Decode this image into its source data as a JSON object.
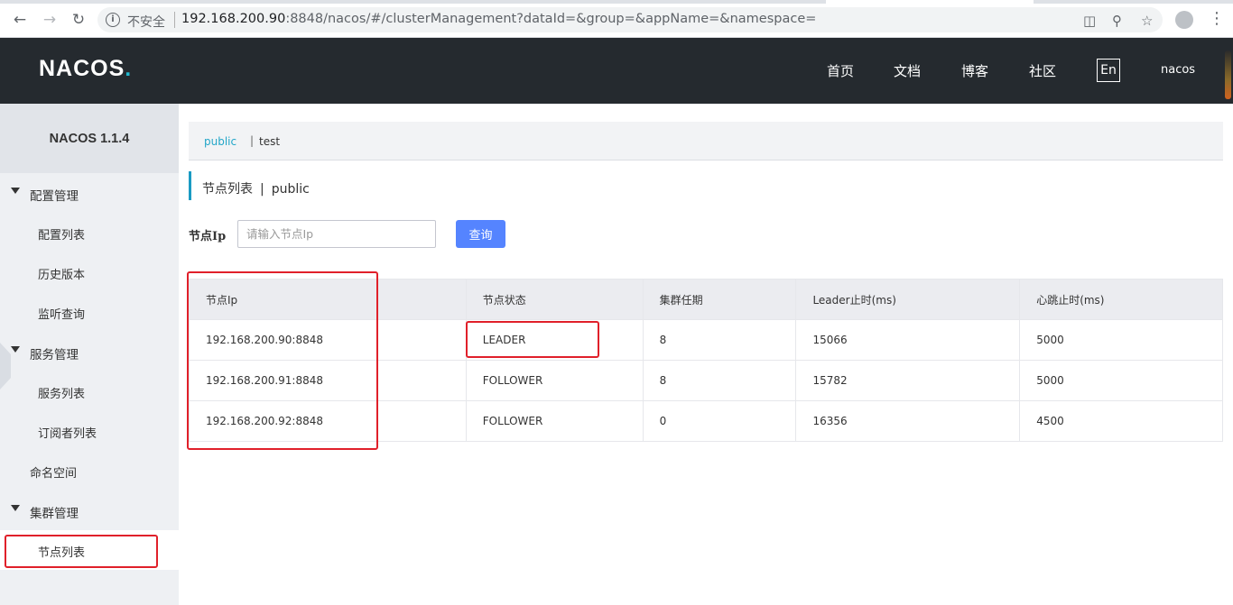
{
  "browser": {
    "security_label": "不安全",
    "url_host": "192.168.200.90",
    "url_rest": ":8848/nacos/#/clusterManagement?dataId=&group=&appName=&namespace="
  },
  "topnav": {
    "logo_main": "NACOS",
    "logo_dot": ".",
    "menu": [
      "首页",
      "文档",
      "博客",
      "社区"
    ],
    "lang": "En",
    "user": "nacos"
  },
  "sidebar": {
    "version": "NACOS 1.1.4",
    "config_group": "配置管理",
    "config_items": [
      "配置列表",
      "历史版本",
      "监听查询"
    ],
    "service_group": "服务管理",
    "service_items": [
      "服务列表",
      "订阅者列表"
    ],
    "namespace": "命名空间",
    "cluster_group": "集群管理",
    "cluster_items": [
      "节点列表"
    ]
  },
  "namespace_bar": {
    "active": "public",
    "separator": "|",
    "other": "test"
  },
  "page": {
    "title": "节点列表",
    "separator": "|",
    "namespace": "public"
  },
  "filter": {
    "label": "节点Ip",
    "placeholder": "请输入节点Ip",
    "button": "查询"
  },
  "table": {
    "headers": [
      "节点Ip",
      "节点状态",
      "集群任期",
      "Leader止时(ms)",
      "心跳止时(ms)"
    ],
    "rows": [
      [
        "192.168.200.90:8848",
        "LEADER",
        "8",
        "15066",
        "5000"
      ],
      [
        "192.168.200.91:8848",
        "FOLLOWER",
        "8",
        "15782",
        "5000"
      ],
      [
        "192.168.200.92:8848",
        "FOLLOWER",
        "0",
        "16356",
        "4500"
      ]
    ]
  },
  "colors": {
    "nav_bg": "#252a2f",
    "accent": "#22a6c8",
    "primary_button": "#5584ff",
    "annotation": "#e0202a"
  }
}
